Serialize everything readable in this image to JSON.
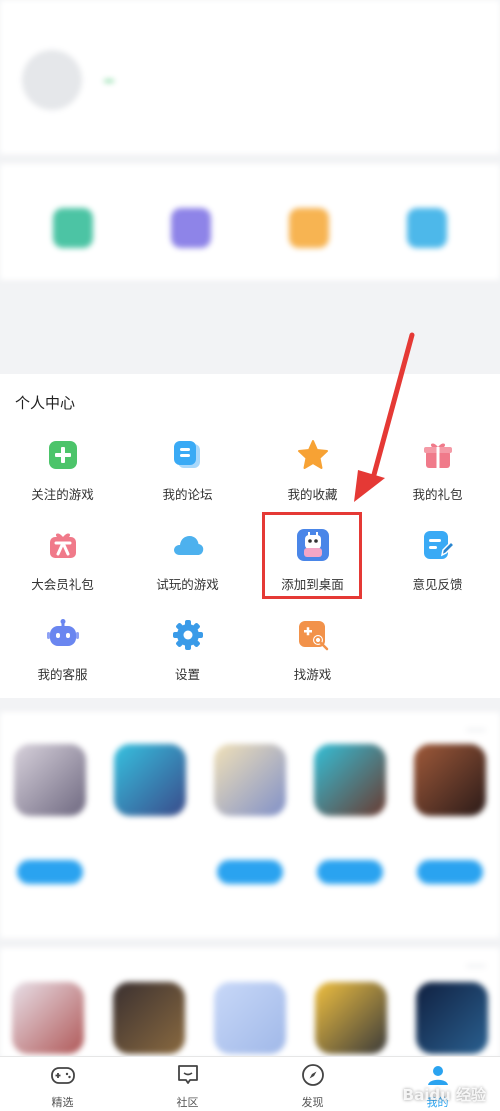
{
  "personal_center": {
    "title": "个人中心",
    "items": [
      {
        "label": "关注的游戏",
        "icon": "plus-square-icon",
        "color": "#4cc46a"
      },
      {
        "label": "我的论坛",
        "icon": "forum-icon",
        "color": "#3aaaf5"
      },
      {
        "label": "我的收藏",
        "icon": "star-icon",
        "color": "#f7a234"
      },
      {
        "label": "我的礼包",
        "icon": "gift-icon",
        "color": "#f07a8a"
      },
      {
        "label": "大会员礼包",
        "icon": "vip-gift-icon",
        "color": "#f07a8a"
      },
      {
        "label": "试玩的游戏",
        "icon": "cloud-icon",
        "color": "#4db1ee"
      },
      {
        "label": "添加到桌面",
        "icon": "app-shortcut-icon",
        "color": "#5a8ef0"
      },
      {
        "label": "意见反馈",
        "icon": "feedback-icon",
        "color": "#3aaaf5"
      },
      {
        "label": "我的客服",
        "icon": "robot-icon",
        "color": "#6a86f0"
      },
      {
        "label": "设置",
        "icon": "gear-icon",
        "color": "#3a9be8"
      },
      {
        "label": "找游戏",
        "icon": "find-game-icon",
        "color": "#f2924a"
      }
    ]
  },
  "nav": {
    "items": [
      {
        "label": "精选",
        "icon": "gamepad-icon"
      },
      {
        "label": "社区",
        "icon": "chat-icon"
      },
      {
        "label": "发现",
        "icon": "compass-icon"
      },
      {
        "label": "我的",
        "icon": "profile-icon",
        "active": true
      }
    ]
  },
  "watermark": "Baidu 经验",
  "colors": {
    "accent": "#2aa3f0",
    "highlight": "#e53935"
  }
}
